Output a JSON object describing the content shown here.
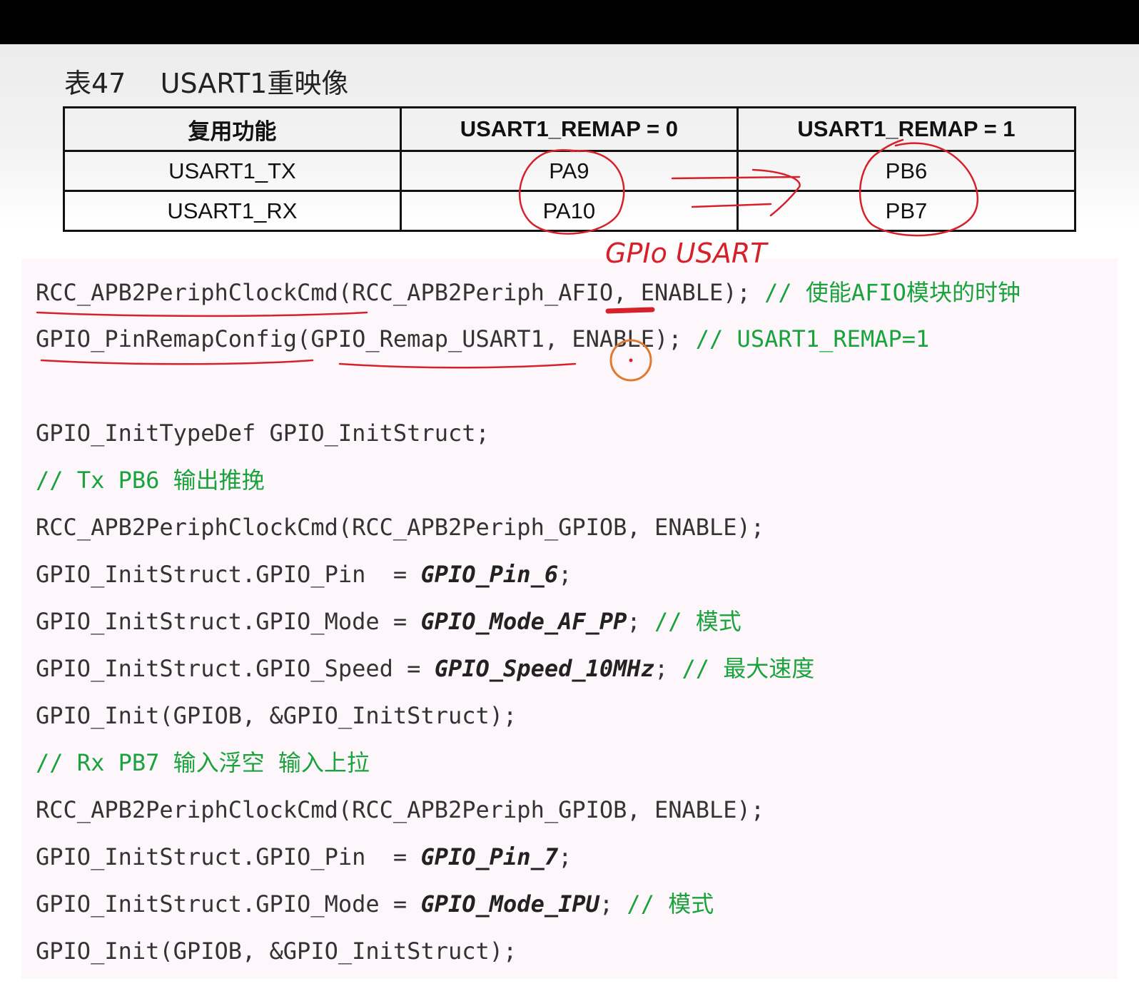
{
  "caption": "表47    USART1重映像",
  "table": {
    "headers": [
      "复用功能",
      "USART1_REMAP = 0",
      "USART1_REMAP = 1"
    ],
    "rows": [
      [
        "USART1_TX",
        "PA9",
        "PB6"
      ],
      [
        "USART1_RX",
        "PA10",
        "PB7"
      ]
    ]
  },
  "code": [
    {
      "code": "RCC_APB2PeriphClockCmd(RCC_APB2Periph_AFIO, ENABLE); ",
      "comment": "// 使能AFIO模块的时钟"
    },
    {
      "code": "GPIO_PinRemapConfig(GPIO_Remap_USART1, ENABLE); ",
      "comment": "// USART1_REMAP=1"
    },
    {
      "code": "GPIO_InitTypeDef GPIO_InitStruct;"
    },
    {
      "comment": "// Tx PB6 输出推挽"
    },
    {
      "code": "RCC_APB2PeriphClockCmd(RCC_APB2Periph_GPIOB, ENABLE);"
    },
    {
      "code": "GPIO_InitStruct.GPIO_Pin  = ",
      "value": "GPIO_Pin_6",
      "tail": ";"
    },
    {
      "code": "GPIO_InitStruct.GPIO_Mode = ",
      "value": "GPIO_Mode_AF_PP",
      "tail": "; ",
      "comment": "// 模式"
    },
    {
      "code": "GPIO_InitStruct.GPIO_Speed = ",
      "value": "GPIO_Speed_10MHz",
      "tail": "; ",
      "comment": "// 最大速度"
    },
    {
      "code": "GPIO_Init(GPIOB, &GPIO_InitStruct);"
    },
    {
      "comment": "// Rx PB7 输入浮空 输入上拉"
    },
    {
      "code": "RCC_APB2PeriphClockCmd(RCC_APB2Periph_GPIOB, ENABLE);"
    },
    {
      "code": "GPIO_InitStruct.GPIO_Pin  = ",
      "value": "GPIO_Pin_7",
      "tail": ";"
    },
    {
      "code": "GPIO_InitStruct.GPIO_Mode = ",
      "value": "GPIO_Mode_IPU",
      "tail": "; ",
      "comment": "// 模式"
    },
    {
      "code": "GPIO_Init(GPIOB, &GPIO_InitStruct);"
    }
  ],
  "annotation": "GPIo USART",
  "colors": {
    "comment": "#1aa33c",
    "annotation": "#d6202a",
    "cursor": "#e07a30"
  }
}
